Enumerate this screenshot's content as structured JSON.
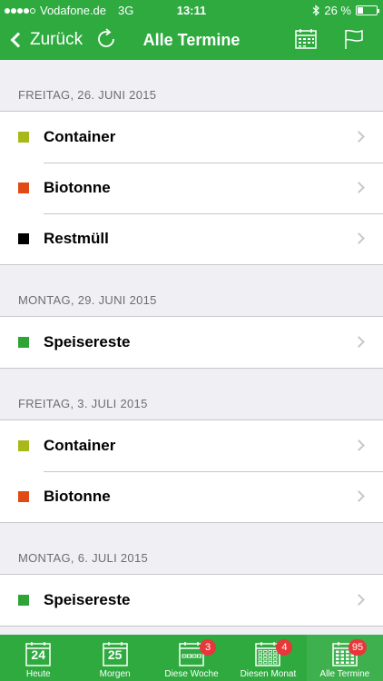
{
  "status_bar": {
    "carrier": "Vodafone.de",
    "network": "3G",
    "time": "13:11",
    "battery_text": "26 %",
    "battery_level": 0.26,
    "signal_bars_filled": 4,
    "signal_bars_total": 5,
    "icons": [
      "bluetooth-icon",
      "battery-icon"
    ]
  },
  "nav": {
    "back_label": "Zurück",
    "title": "Alle Termine",
    "icons": [
      "refresh-icon",
      "calendar-icon",
      "flag-icon"
    ]
  },
  "colors": {
    "brand_green": "#2eaa3f",
    "container": "#a8b819",
    "biotonne": "#e04a14",
    "restmuell": "#000000",
    "speisereste": "#2ea336",
    "badge_red": "#e8373a"
  },
  "sections": [
    {
      "date": "FREITAG, 26. JUNI 2015",
      "items": [
        {
          "label": "Container",
          "color": "#a8b819"
        },
        {
          "label": "Biotonne",
          "color": "#e04a14"
        },
        {
          "label": "Restmüll",
          "color": "#000000"
        }
      ]
    },
    {
      "date": "MONTAG, 29. JUNI 2015",
      "items": [
        {
          "label": "Speisereste",
          "color": "#2ea336"
        }
      ]
    },
    {
      "date": "FREITAG, 3. JULI 2015",
      "items": [
        {
          "label": "Container",
          "color": "#a8b819"
        },
        {
          "label": "Biotonne",
          "color": "#e04a14"
        }
      ]
    },
    {
      "date": "MONTAG, 6. JULI 2015",
      "items": [
        {
          "label": "Speisereste",
          "color": "#2ea336"
        }
      ]
    }
  ],
  "tabs": [
    {
      "label": "Heute",
      "day": "24",
      "badge": null,
      "icon": "calendar-day-icon"
    },
    {
      "label": "Morgen",
      "day": "25",
      "badge": null,
      "icon": "calendar-day-icon"
    },
    {
      "label": "Diese Woche",
      "day": null,
      "badge": "3",
      "icon": "calendar-week-icon"
    },
    {
      "label": "Diesen Monat",
      "day": null,
      "badge": "4",
      "icon": "calendar-month-icon"
    },
    {
      "label": "Alle Termine",
      "day": null,
      "badge": "95",
      "icon": "calendar-all-icon",
      "active": true
    }
  ]
}
